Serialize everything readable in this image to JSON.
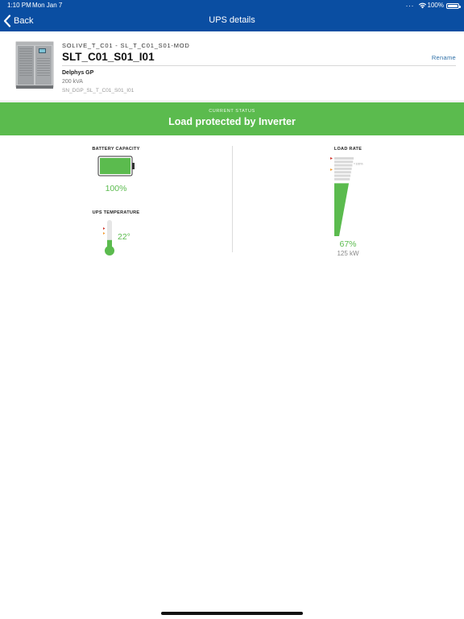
{
  "status_bar": {
    "time": "1:10 PM",
    "date": "Mon Jan 7",
    "battery_percent": "100%"
  },
  "nav": {
    "back_label": "Back",
    "title": "UPS details"
  },
  "device": {
    "path": "SOLIVE_T_C01 - SL_T_C01_S01-MOD",
    "name": "SLT_C01_S01_I01",
    "rename_label": "Rename",
    "model": "Delphys GP",
    "power": "200 kVA",
    "serial": "SN_DGP_SL_T_C01_S01_I01"
  },
  "status_banner": {
    "label": "CURRENT STATUS",
    "value": "Load protected by Inverter"
  },
  "battery": {
    "title": "BATTERY CAPACITY",
    "value": "100%",
    "level": 1.0
  },
  "temperature": {
    "title": "UPS TEMPERATURE",
    "value": "22°",
    "level": 0.2
  },
  "load": {
    "title": "LOAD RATE",
    "value": "67%",
    "power": "125 kW",
    "level": 0.67,
    "scale_label": "100%"
  },
  "colors": {
    "header_blue": "#0a4ea2",
    "status_green": "#5bbb4e",
    "link_blue": "#2e6fa7",
    "marker_red": "#d0342c",
    "marker_orange": "#f29b30"
  },
  "icons": [
    "chevron-left-icon",
    "wifi-icon",
    "battery-status-icon",
    "ups-cabinet-image",
    "battery-gauge-icon",
    "thermometer-icon",
    "load-gauge-icon"
  ]
}
